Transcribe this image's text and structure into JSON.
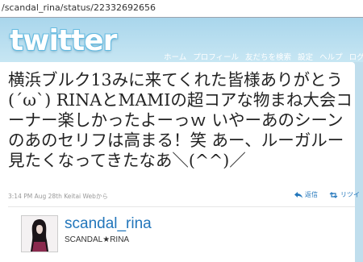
{
  "browser": {
    "url": "/scandal_rina/status/22332692656"
  },
  "header": {
    "logo_text": "twitter",
    "nav": [
      "ホーム",
      "プロフィール",
      "友だちを検索",
      "設定",
      "ヘルプ",
      "ログ"
    ]
  },
  "tweet": {
    "text": "横浜ブルク13みに来てくれた皆様ありがとう(´ω`) RINAとMAMIの超コアな物まね大会コーナー楽しかったよーっｗ いやーあのシーンのあのセリフは高まる！笑 あー、ルーガルー見たくなってきたなあ＼(^^)／",
    "meta": "3:14 PM Aug 28th Keitai Webから",
    "actions": {
      "reply": "返信",
      "retweet": "リツイ"
    }
  },
  "author": {
    "username": "scandal_rina",
    "full_name": "SCANDAL★RINA"
  },
  "colors": {
    "background": "#c0deed",
    "link": "#2276bb",
    "card": "#ffffff"
  }
}
